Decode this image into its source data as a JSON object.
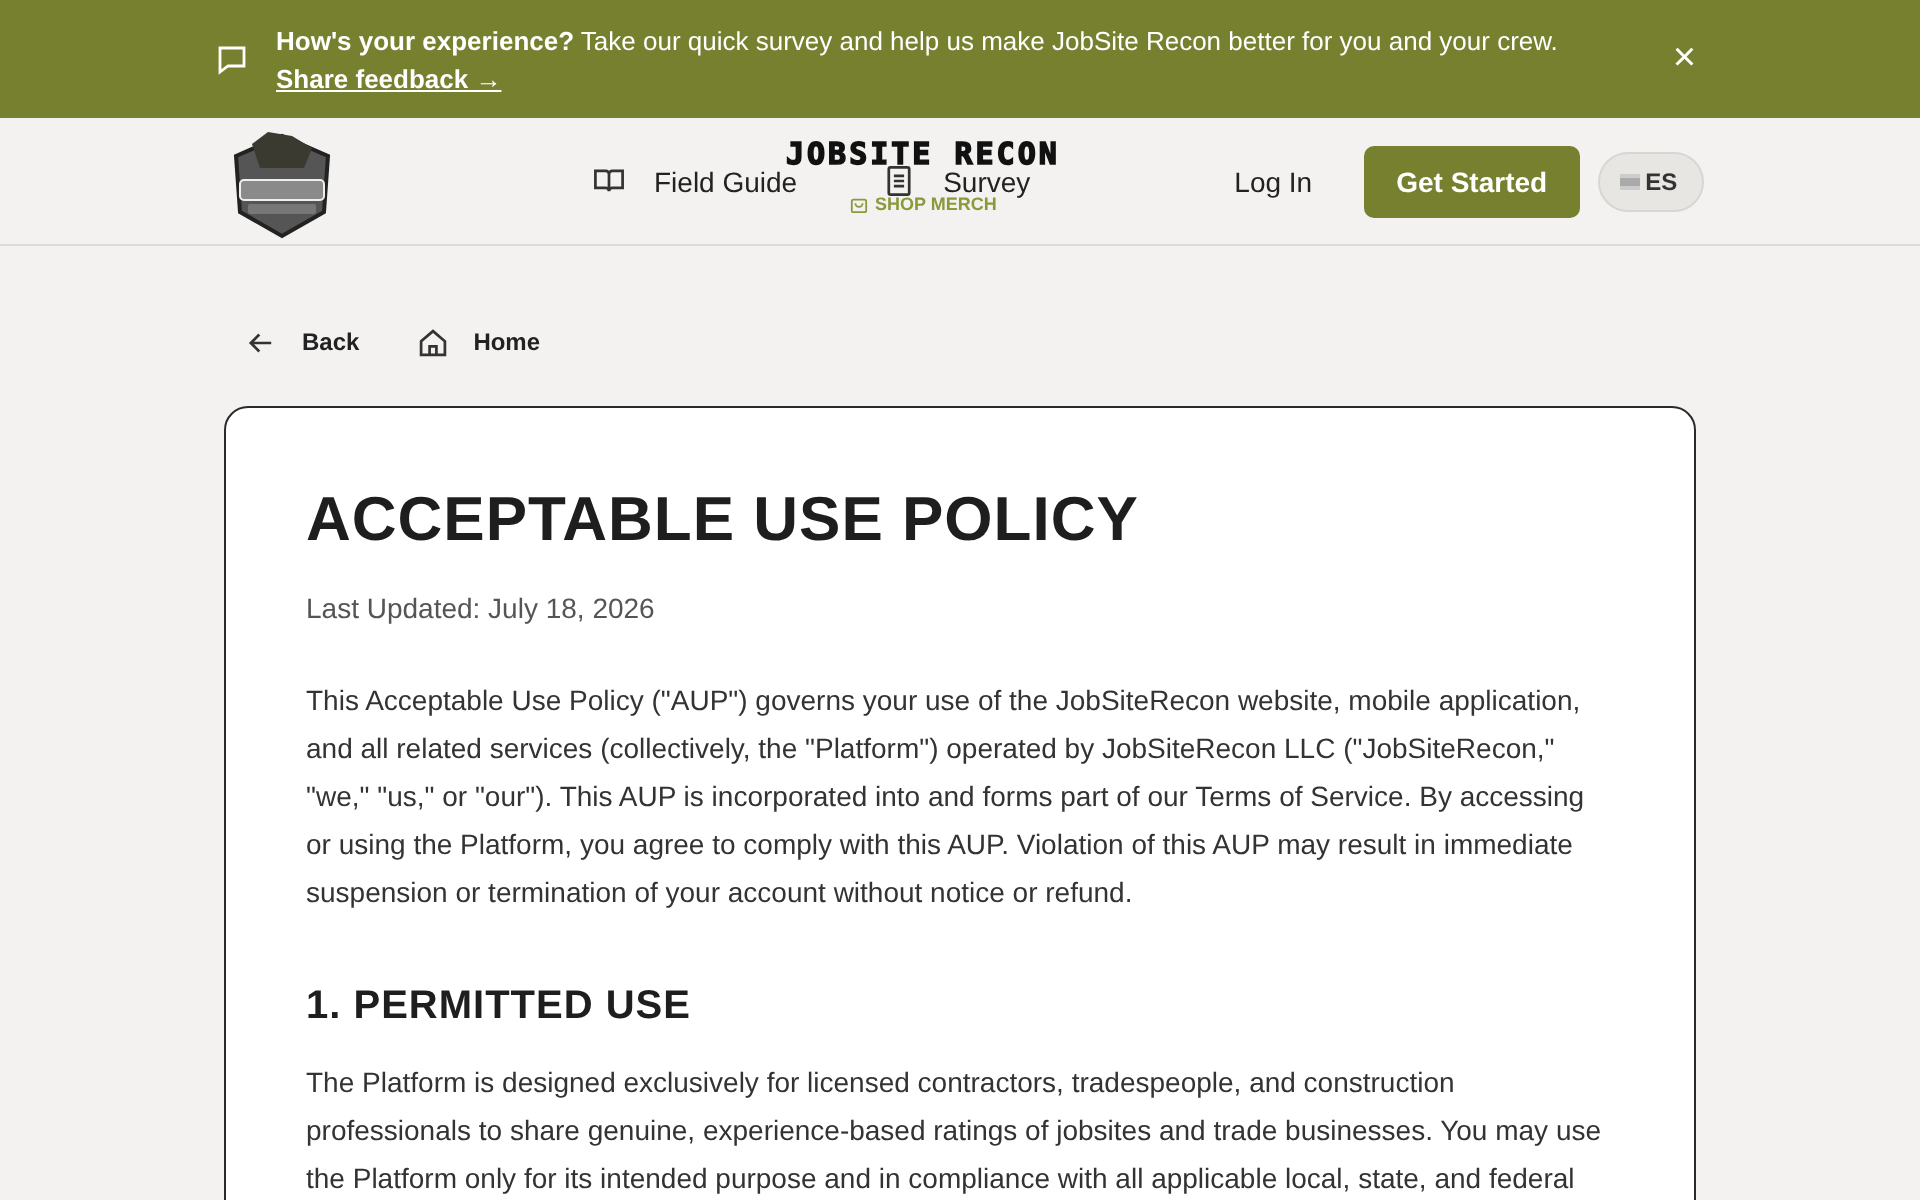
{
  "banner": {
    "lead": "How's your experience?",
    "text": "Take our quick survey and help us make JobSite Recon better for you and your crew.",
    "link": "Share feedback →",
    "close": "×"
  },
  "header": {
    "brand": "JOBSITE RECON",
    "merch": "SHOP MERCH",
    "nav": [
      {
        "label": "Field Guide"
      },
      {
        "label": "Survey"
      }
    ],
    "login": "Log In",
    "cta": "Get Started",
    "language": "ES"
  },
  "breadcrumbs": [
    {
      "label": "Back"
    },
    {
      "label": "Home"
    }
  ],
  "policy": {
    "title": "ACCEPTABLE USE POLICY",
    "updated": "Last Updated: July 18, 2026",
    "intro": "This Acceptable Use Policy (\"AUP\") governs your use of the JobSiteRecon website, mobile application, and all related services (collectively, the \"Platform\") operated by JobSiteRecon LLC (\"JobSiteRecon,\" \"we,\" \"us,\" or \"our\"). This AUP is incorporated into and forms part of our Terms of Service. By accessing or using the Platform, you agree to comply with this AUP. Violation of this AUP may result in immediate suspension or termination of your account without notice or refund.",
    "sections": [
      {
        "heading": "1. PERMITTED USE",
        "body": "The Platform is designed exclusively for licensed contractors, tradespeople, and construction professionals to share genuine, experience-based ratings of jobsites and trade businesses. You may use the Platform only for its intended purpose and in compliance with all applicable local, state, and federal"
      }
    ]
  }
}
